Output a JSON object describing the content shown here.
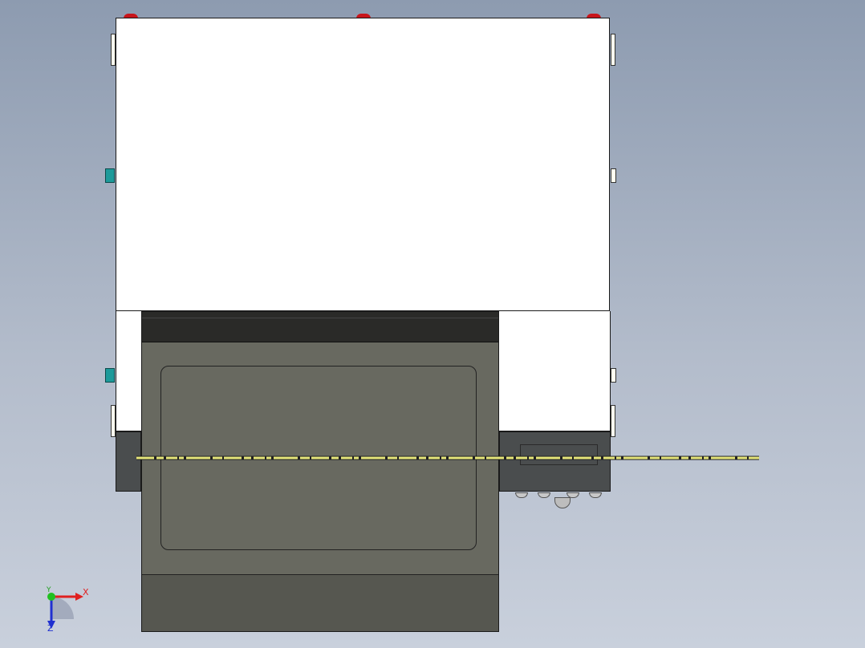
{
  "viewport": {
    "background_gradient": [
      "#8d9bb0",
      "#c9d0dc"
    ]
  },
  "model": {
    "colors": {
      "panel": "#ffffff",
      "drawer": "#686960",
      "drawer_top": "#2a2a28",
      "feet": "#4a4d4e",
      "knob": "#c8151b",
      "connector": "#1d9a9a",
      "rail": "#e6e67a"
    }
  },
  "triad": {
    "x_label": "X",
    "y_label": "Y",
    "z_label": "Z",
    "colors": {
      "x": "#e02020",
      "y": "#20c020",
      "z": "#2030d0"
    }
  }
}
